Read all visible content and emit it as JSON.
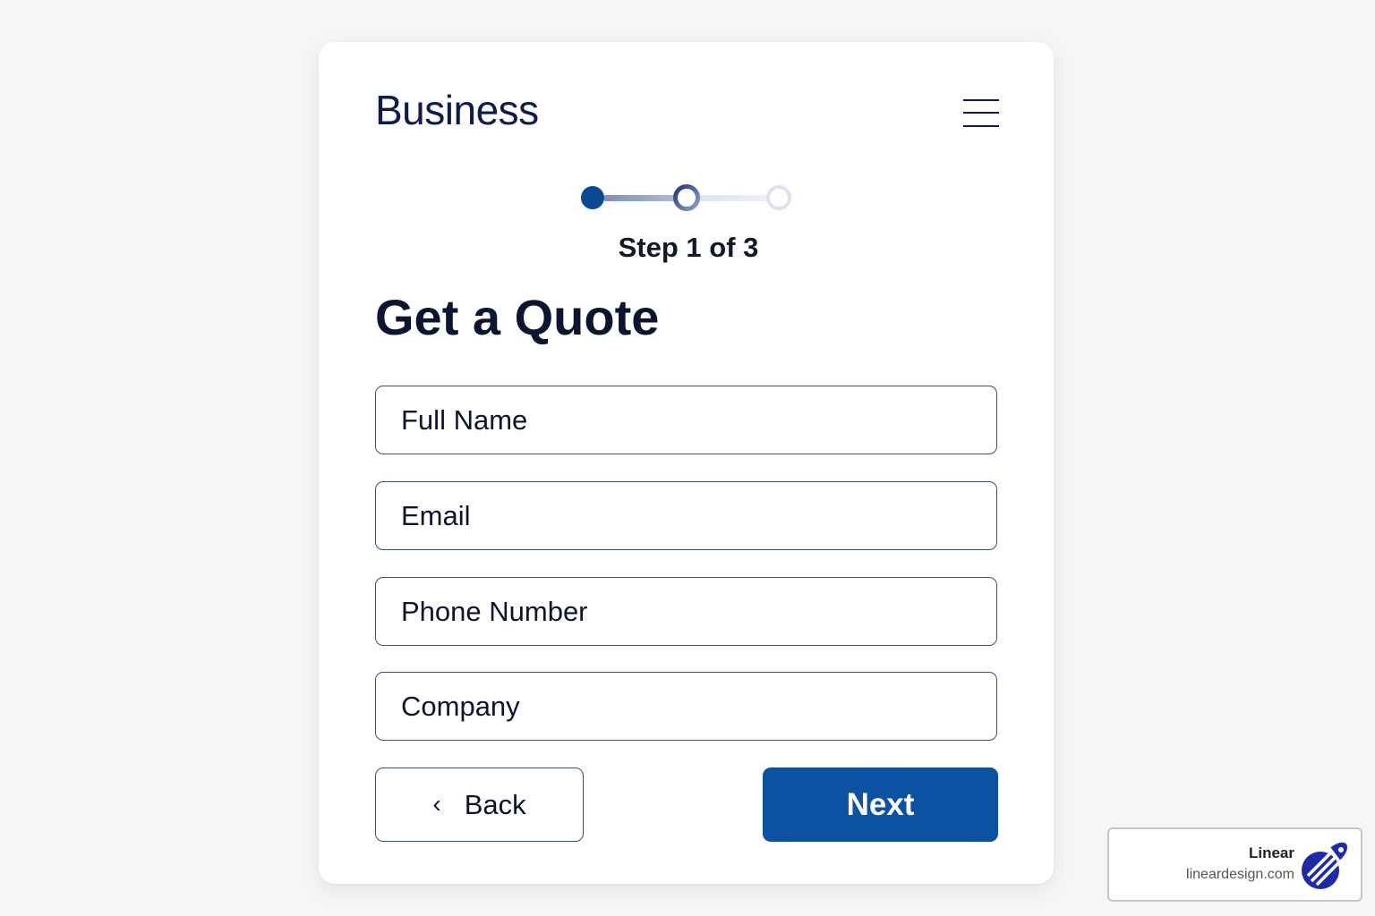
{
  "header": {
    "brand": "Business",
    "menu_icon": "hamburger-menu-icon"
  },
  "progress": {
    "current_step": 1,
    "total_steps": 3,
    "label": "Step 1 of 3",
    "active_color": "#0b4a93"
  },
  "form": {
    "title": "Get a Quote",
    "fields": {
      "full_name": {
        "placeholder": "Full Name",
        "value": ""
      },
      "email": {
        "placeholder": "Email",
        "value": ""
      },
      "phone": {
        "placeholder": "Phone Number",
        "value": ""
      },
      "company": {
        "placeholder": "Company",
        "value": ""
      }
    },
    "back_label": "Back",
    "back_icon": "chevron-left-icon",
    "next_label": "Next",
    "next_color": "#0b52a2"
  },
  "watermark": {
    "name": "Linear",
    "url": "lineardesign.com",
    "logo_icon": "linear-logo-icon"
  }
}
